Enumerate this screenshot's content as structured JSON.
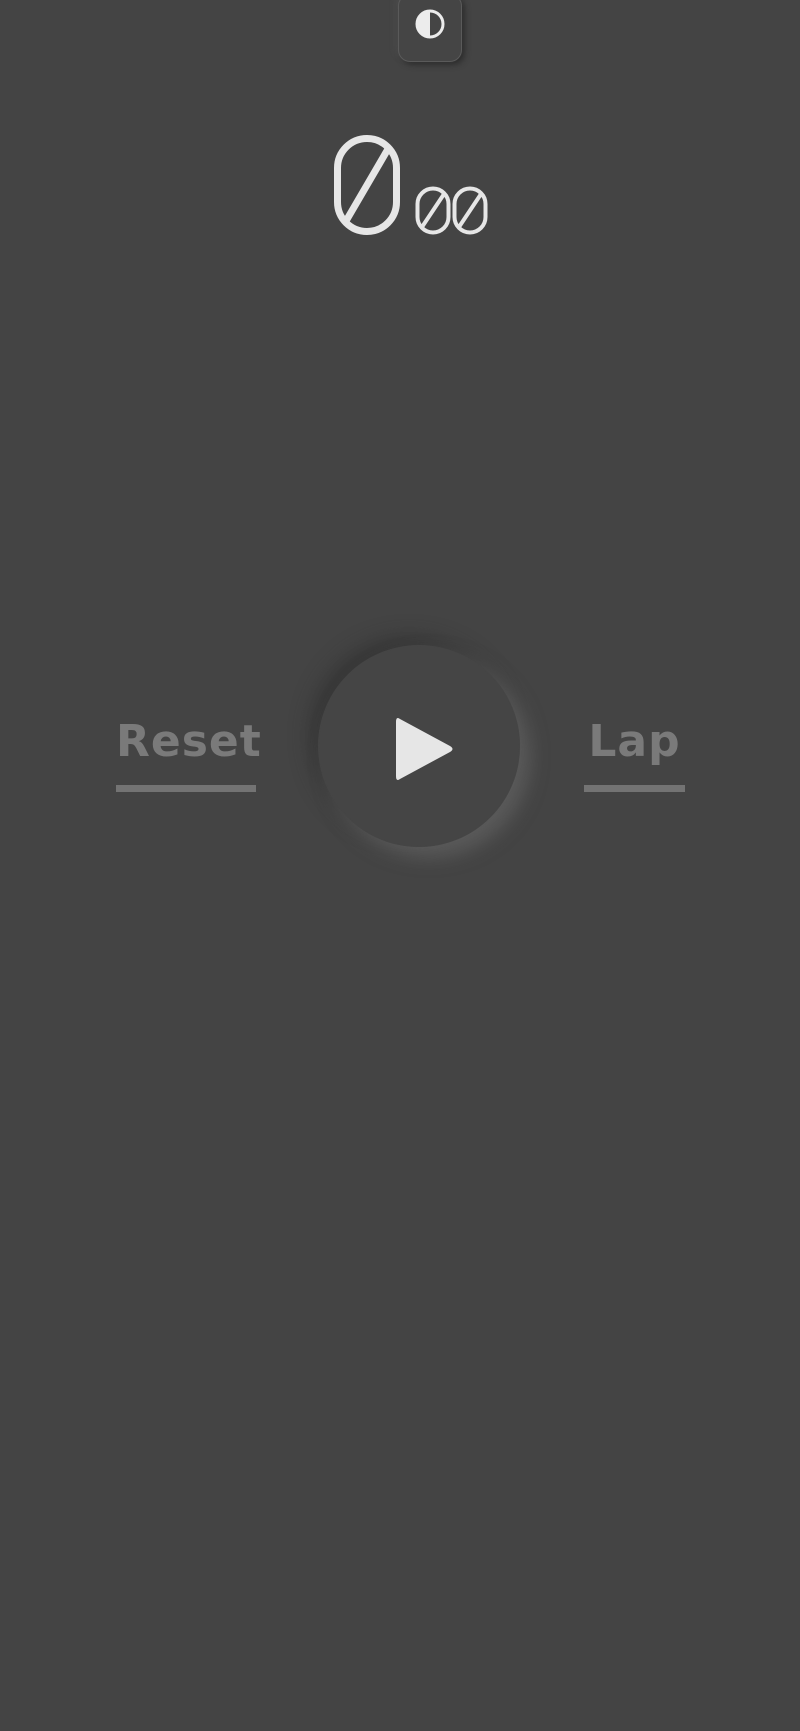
{
  "theme_toggle": {
    "icon": "half-circle-contrast-icon"
  },
  "timer": {
    "seconds": "0",
    "centiseconds": "00"
  },
  "controls": {
    "reset_label": "Reset",
    "lap_label": "Lap",
    "play_icon": "play-icon"
  },
  "colors": {
    "background": "#444444",
    "digit": "#e6e6e6",
    "inactive_label": "#7a7a7a"
  }
}
